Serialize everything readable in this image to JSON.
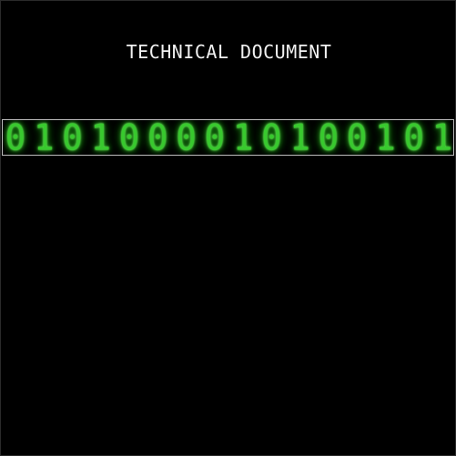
{
  "header": {
    "title": "TECHNICAL DOCUMENT"
  },
  "banner": {
    "digits": [
      "0",
      "1",
      "0",
      "1",
      "0",
      "0",
      "0",
      "0",
      "1",
      "0",
      "1",
      "0",
      "0",
      "1",
      "0",
      "1"
    ]
  },
  "colors": {
    "background": "#000000",
    "title_text": "#f2f2f2",
    "digit_glow": "#38c92e",
    "banner_border": "#bdbdbd"
  }
}
